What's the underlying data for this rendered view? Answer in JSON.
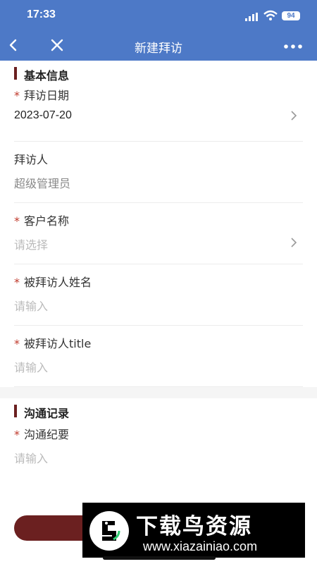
{
  "status_bar": {
    "time": "17:33",
    "battery": "94"
  },
  "nav": {
    "title": "新建拜访"
  },
  "colors": {
    "primary": "#4d79c7",
    "accent": "#6b2020",
    "required": "#c0392b"
  },
  "sections": [
    {
      "title": "基本信息",
      "fields": [
        {
          "label": "拜访日期",
          "required": "*",
          "value": "2023-07-20"
        },
        {
          "label": "拜访人",
          "value": "超级管理员"
        },
        {
          "label": "客户名称",
          "required": "*",
          "placeholder": "请选择"
        },
        {
          "label": "被拜访人姓名",
          "required": "*",
          "placeholder": "请输入"
        },
        {
          "label": "被拜访人title",
          "required": "*",
          "placeholder": "请输入"
        }
      ]
    },
    {
      "title": "沟通记录",
      "fields": [
        {
          "label": "沟通纪要",
          "required": "*",
          "placeholder": "请输入"
        }
      ]
    }
  ],
  "watermark": {
    "name": "下载鸟资源",
    "url": "www.xiazainiao.com"
  }
}
